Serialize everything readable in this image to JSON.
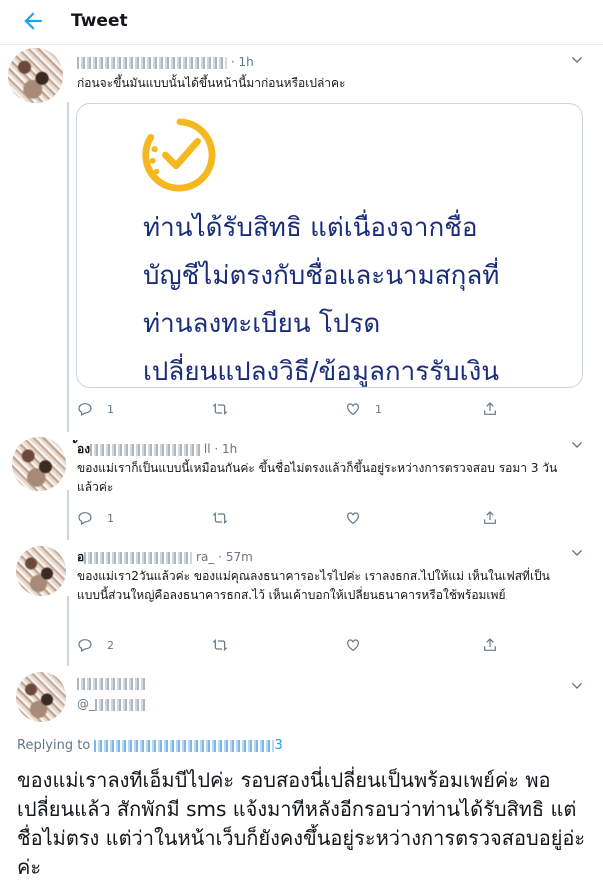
{
  "header": {
    "title": "Tweet"
  },
  "tweets": [
    {
      "time": "1h",
      "text": "ก่อนจะขึ้นมันแบบนั้นได้ขึ้นหน้านี้มาก่อนหรือเปล่าคะ",
      "card_text": [
        "ท่านได้รับสิทธิ แต่เนื่องจากชื่อ",
        "บัญชีไม่ตรงกับชื่อและนามสกุลที่",
        "ท่านลงทะเบียน โปรด",
        "เปลี่ยนแปลงวิธี/ข้อมูลการรับเงิน"
      ],
      "replies": "1",
      "retweets": "",
      "likes": "1"
    },
    {
      "name_visible": "้อง",
      "handle_visible": "ll",
      "time": "1h",
      "text": "ของแม่เราก็เป็นแบบนี้เหมือนกันค่ะ ขึ้นชื่อไม่ตรงแล้วก็ขึ้นอยู่ระหว่างการตรวจสอบ รอมา 3 วันแล้วค่ะ",
      "replies": "1",
      "retweets": "",
      "likes": ""
    },
    {
      "name_visible": "อ",
      "handle_visible": "ra_",
      "time": "57m",
      "text": "ของแม่เรา2วันแล้วค่ะ ของแม่คุณลงธนาคารอะไรไปค่ะ เราลงธกส.ไปให้แม่ เห็นในเฟสที่เป็นแบบนี้ส่วนใหญ่คือลงธนาคารธกส.ไว้ เห็นเค้าบอกให้เปลี่ยนธนาคารหรือใช้พร้อมเพย์",
      "replies": "2",
      "retweets": "",
      "likes": ""
    }
  ],
  "main_tweet": {
    "handle_visible": "@_",
    "replying_label": "Replying to",
    "replying_tail": "3",
    "text": "ของแม่เราลงทีเอ็มบีไปค่ะ รอบสองนี่เปลี่ยนเป็นพร้อมเพย์ค่ะ พอเปลี่ยนแล้ว สักพักมี sms แจ้งมาทีหลังอีกรอบว่าท่านได้รับสิทธิ แต่ชื่อไม่ตรง แต่ว่าในหน้าเว็บก็ยังคงขึ้นอยู่ระหว่างการตรวจสอบอยู่อ่ะค่ะ"
  },
  "colors": {
    "accent": "#1da1f2",
    "card_text": "#1a2d7a",
    "check_yellow": "#f5b820",
    "muted": "#657786"
  },
  "icons": [
    "back-arrow-icon",
    "chevron-down-icon",
    "reply-icon",
    "retweet-icon",
    "like-icon",
    "share-icon",
    "check-circle-icon"
  ]
}
